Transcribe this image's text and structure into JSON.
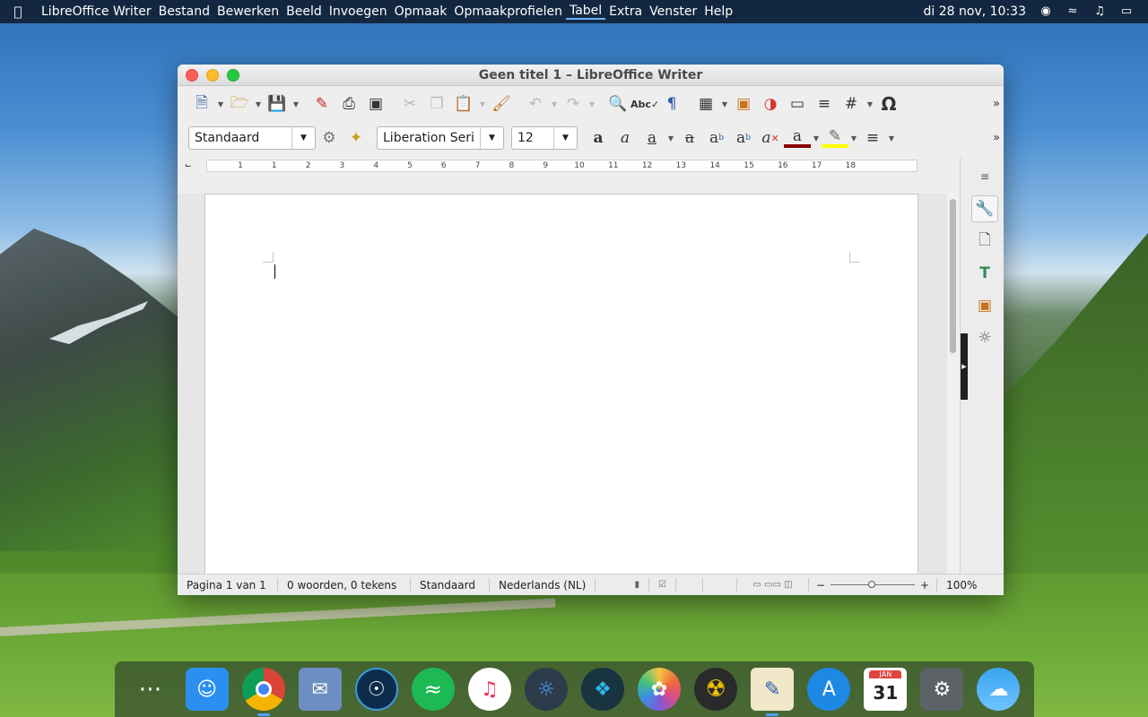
{
  "menubar": {
    "app_name": "LibreOffice Writer",
    "items": [
      "Bestand",
      "Bewerken",
      "Beeld",
      "Invoegen",
      "Opmaak",
      "Opmaakprofielen",
      "Tabel",
      "Extra",
      "Venster",
      "Help"
    ],
    "active_item": "Tabel",
    "clock": "di 28 nov, 10:33"
  },
  "window": {
    "title": "Geen titel 1 – LibreOffice Writer"
  },
  "formatting": {
    "paragraph_style": "Standaard",
    "font_name": "Liberation Seri",
    "font_size": "12"
  },
  "ruler": {
    "ticks": [
      "1",
      "1",
      "2",
      "3",
      "4",
      "5",
      "6",
      "7",
      "8",
      "9",
      "10",
      "11",
      "12",
      "13",
      "14",
      "15",
      "16",
      "17",
      "18"
    ]
  },
  "statusbar": {
    "page": "Pagina 1 van 1",
    "words": "0 woorden, 0 tekens",
    "style": "Standaard",
    "language": "Nederlands (NL)",
    "zoom_percent": "100%",
    "zoom_minus": "−",
    "zoom_plus": "+"
  },
  "calendar": {
    "month": "JAN",
    "day": "31"
  },
  "colors": {
    "menubar_bg": "#0c121e",
    "font_color": "#8b0000",
    "highlight": "#ffff00",
    "accent": "#4aa3ff"
  }
}
